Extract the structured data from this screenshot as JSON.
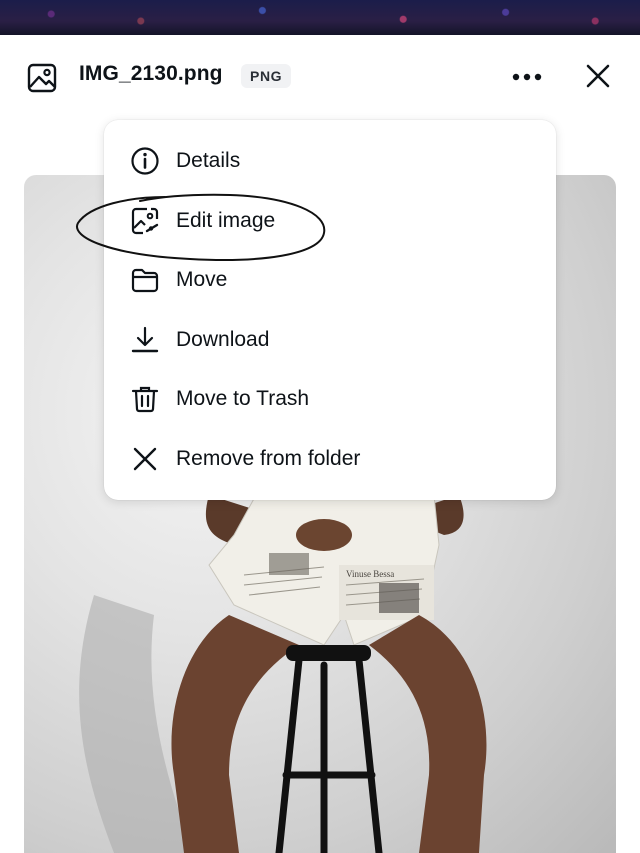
{
  "header": {
    "file_name": "IMG_2130.png",
    "file_type": "PNG"
  },
  "menu": {
    "items": [
      {
        "label": "Details",
        "icon": "info-icon"
      },
      {
        "label": "Edit image",
        "icon": "edit-image-icon"
      },
      {
        "label": "Move",
        "icon": "folder-icon"
      },
      {
        "label": "Download",
        "icon": "download-icon"
      },
      {
        "label": "Move to Trash",
        "icon": "trash-icon"
      },
      {
        "label": "Remove from folder",
        "icon": "close-icon"
      }
    ]
  },
  "photo": {
    "headline_text": "Vinuse Bessa"
  },
  "colors": {
    "text": "#0e1318",
    "badge_bg": "#f1f2f4",
    "menu_bg": "#ffffff",
    "annotation_ink": "#111111"
  }
}
